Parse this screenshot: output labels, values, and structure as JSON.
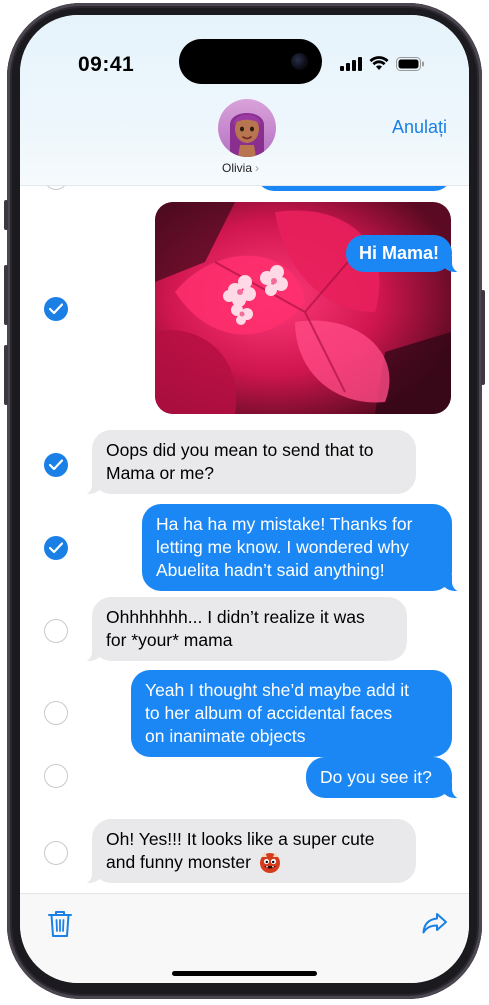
{
  "status_bar": {
    "time": "09:41"
  },
  "header": {
    "contact_name": "Olivia",
    "cancel_label": "Anulați"
  },
  "messages": [
    {
      "id": "m0",
      "direction": "out",
      "text": "",
      "selected": false,
      "partial": true
    },
    {
      "id": "m1",
      "direction": "out",
      "type": "photo",
      "overlay_text": "Hi Mama!",
      "selected": true
    },
    {
      "id": "m2",
      "direction": "in",
      "text": "Oops did you mean to send that to Mama or me?",
      "lines": [
        "Oops did you mean to send that to",
        "Mama or me?"
      ],
      "selected": true
    },
    {
      "id": "m3",
      "direction": "out",
      "lines": [
        "Ha ha ha my mistake! Thanks for",
        "letting me know. I wondered why",
        "Abuelita hadn’t said anything!"
      ],
      "selected": true
    },
    {
      "id": "m4",
      "direction": "in",
      "lines": [
        "Ohhhhhhh... I didn’t realize it was",
        "for *your* mama"
      ],
      "selected": false
    },
    {
      "id": "m5",
      "direction": "out",
      "lines": [
        "Yeah I thought she’d maybe add it",
        "to her album of accidental faces",
        "on inanimate objects"
      ],
      "selected": false
    },
    {
      "id": "m6",
      "direction": "out",
      "lines": [
        "Do you see it?"
      ],
      "selected": false
    },
    {
      "id": "m7",
      "direction": "in",
      "lines": [
        "Oh! Yes!!! It looks like a super cute",
        "and funny monster"
      ],
      "emoji": "monster-face-emoji",
      "selected": false
    }
  ],
  "toolbar": {
    "left_icon": "trash-icon",
    "right_icon": "share-arrow-icon"
  },
  "colors": {
    "accent": "#1a80e5",
    "outgoing_bubble": "#1a87f5",
    "incoming_bubble": "#e9e9eb",
    "header_bg": "#e6f3fb"
  }
}
